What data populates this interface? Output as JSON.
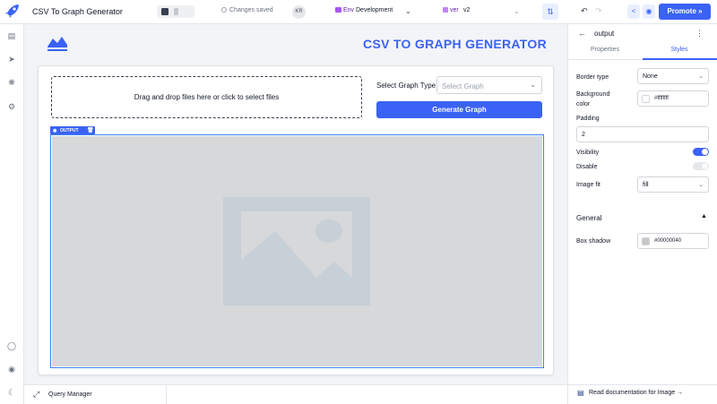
{
  "topbar": {
    "app_title": "CSV To Graph Generator",
    "save_status": "Changes saved",
    "avatar_initials": "KR",
    "env_label": "Env",
    "env_value": "Development",
    "version_label": "ver",
    "version_value": "v2",
    "promote_label": "Promote"
  },
  "canvas": {
    "header_title": "CSV TO GRAPH GENERATOR",
    "dropzone_text": "Drag and drop files here or click to select files",
    "graph_type_label": "Select Graph Type",
    "graph_type_placeholder": "Select Graph",
    "generate_button": "Generate Graph",
    "output_tag": "OUTPUT"
  },
  "bottombar": {
    "query_manager": "Query Manager"
  },
  "inspector": {
    "component_name": "output",
    "tabs": [
      "Properties",
      "Styles"
    ],
    "active_tab": "Styles",
    "border_type_label": "Border type",
    "border_type_value": "None",
    "background_color_label_1": "Background",
    "background_color_label_2": "color",
    "background_color_value": "#ffffffff",
    "padding_label": "Padding",
    "padding_value": "2",
    "visibility_label": "Visibility",
    "visibility_on": true,
    "disable_label": "Disable",
    "disable_on": false,
    "image_fit_label": "Image fit",
    "image_fit_value": "fill",
    "section_general": "General",
    "box_shadow_label": "Box shadow",
    "box_shadow_value": "#00000040",
    "doc_link": "Read documentation for Image →"
  },
  "colors": {
    "accent": "#3b62f6",
    "image_placeholder": "#d6d8da",
    "box_shadow_swatch": "#c7c7c7"
  }
}
